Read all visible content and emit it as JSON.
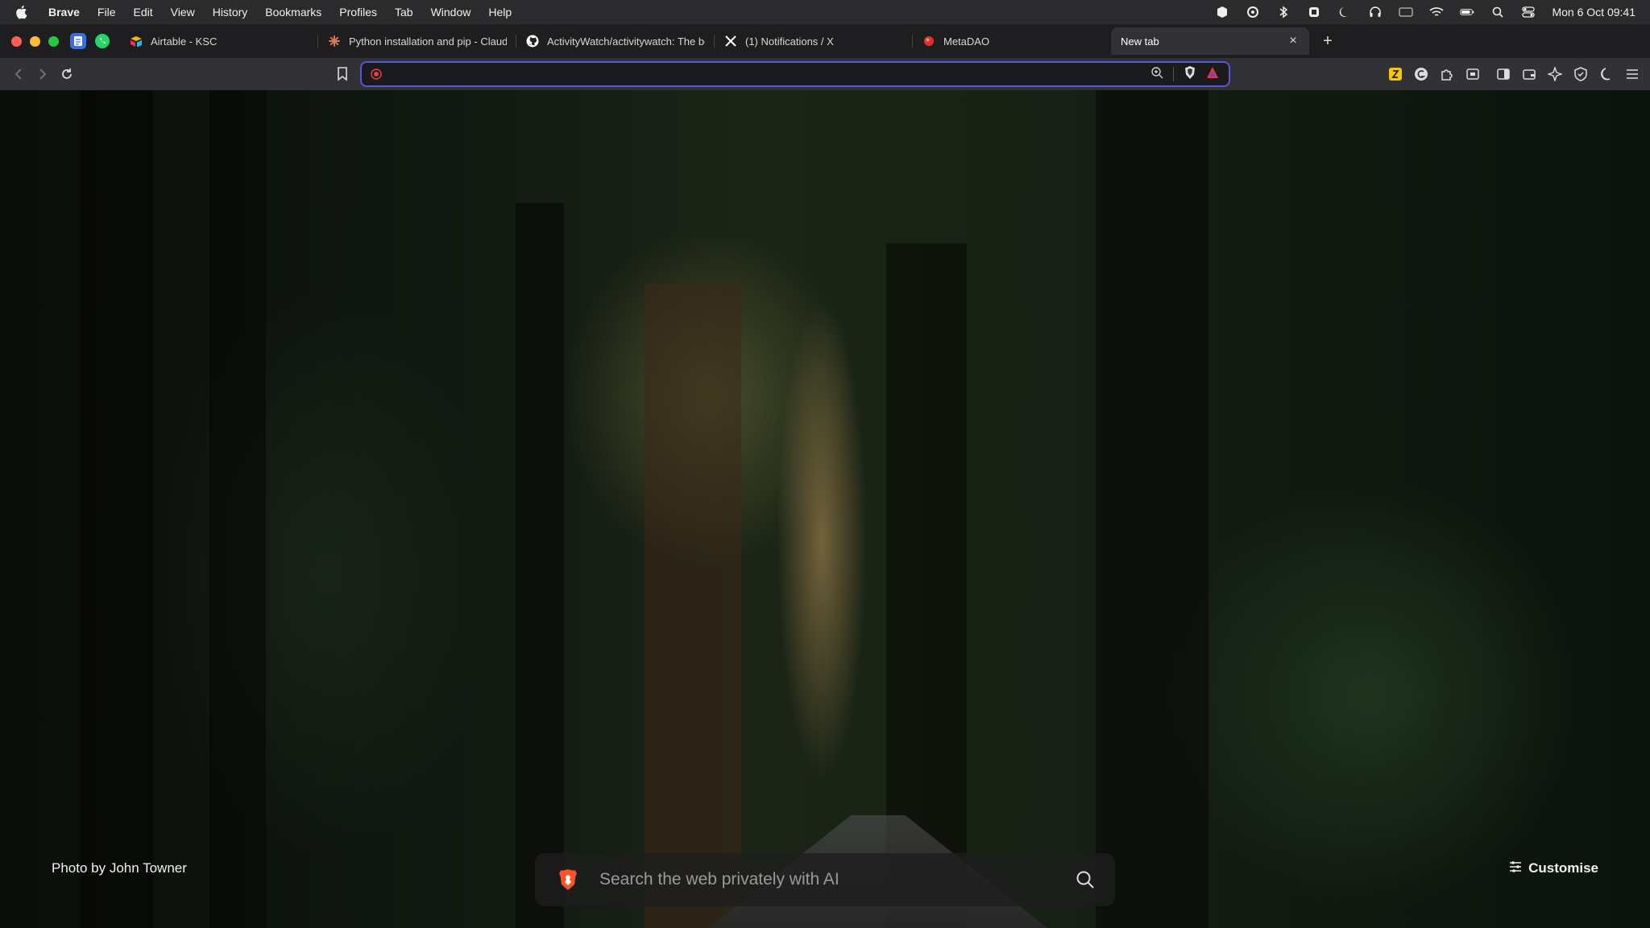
{
  "menubar": {
    "app_name": "Brave",
    "items": [
      "File",
      "Edit",
      "View",
      "History",
      "Bookmarks",
      "Profiles",
      "Tab",
      "Window",
      "Help"
    ],
    "clock": "Mon 6 Oct  09:41"
  },
  "tabs": [
    {
      "label": "Airtable - KSC",
      "icon": "airtable-icon",
      "color": "#f4b400"
    },
    {
      "label": "Python installation and pip - Claude",
      "icon": "claude-icon",
      "color": "#d97757"
    },
    {
      "label": "ActivityWatch/activitywatch: The best",
      "icon": "github-icon",
      "color": "#ffffff"
    },
    {
      "label": "(1) Notifications / X",
      "icon": "x-icon",
      "color": "#ffffff"
    },
    {
      "label": "MetaDAO",
      "icon": "metadao-icon",
      "color": "#e0322b"
    },
    {
      "label": "New tab",
      "icon": "",
      "color": "",
      "active": true
    }
  ],
  "address_bar": {
    "value": "",
    "placeholder": ""
  },
  "colors": {
    "accent": "#5a54d6",
    "brave_orange": "#fb542b"
  },
  "newtab": {
    "photo_credit": "Photo by John Towner",
    "search_placeholder": "Search the web privately with AI",
    "customise_label": "Customise"
  }
}
